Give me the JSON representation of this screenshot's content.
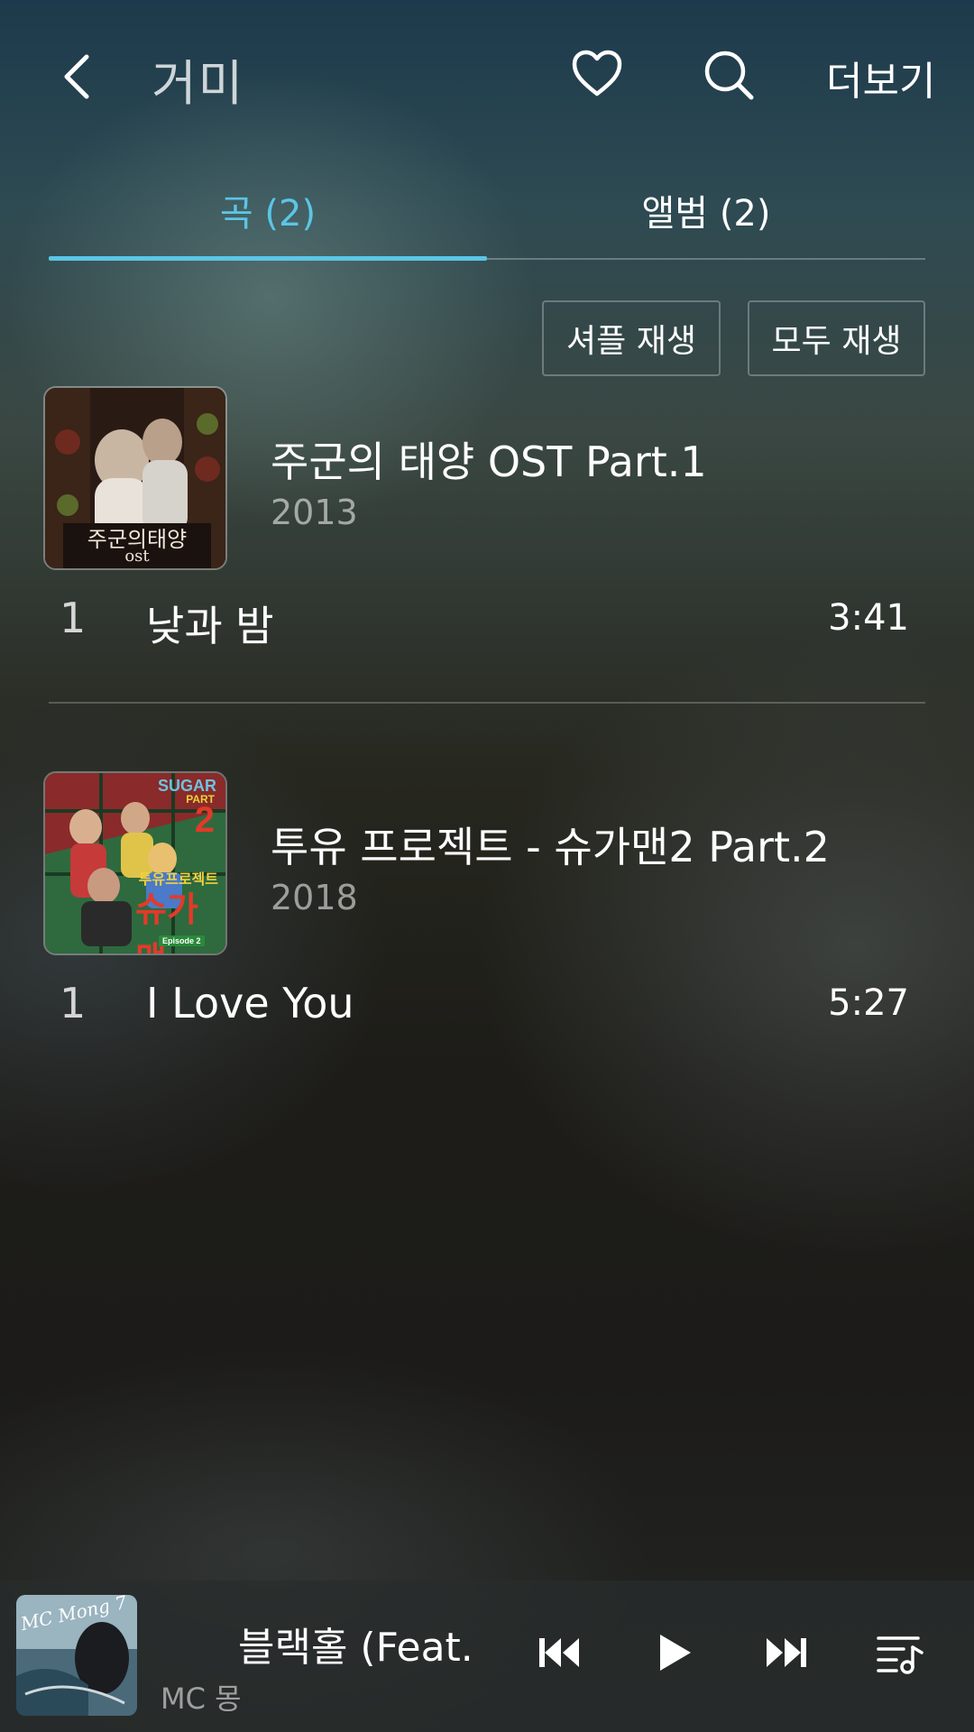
{
  "header": {
    "title": "거미",
    "more_label": "더보기"
  },
  "tabs": [
    {
      "label": "곡 (2)",
      "active": true
    },
    {
      "label": "앨범 (2)",
      "active": false
    }
  ],
  "actions": {
    "shuffle_label": "셔플 재생",
    "play_all_label": "모두 재생"
  },
  "albums": [
    {
      "title": "주군의 태양 OST Part.1",
      "year": "2013",
      "cover_text": "주군의태양",
      "cover_sub": "ost",
      "tracks": [
        {
          "number": "1",
          "title": "낮과 밤",
          "duration": "3:41"
        }
      ]
    },
    {
      "title": "투유 프로젝트 - 슈가맨2 Part.2",
      "year": "2018",
      "cover_text": "슈가맨",
      "cover_badge": "SUGAR",
      "cover_part": "PART",
      "cover_num": "2",
      "cover_project": "투유프로젝트",
      "cover_episode": "Episode 2",
      "tracks": [
        {
          "number": "1",
          "title": "I Love You",
          "duration": "5:27"
        }
      ]
    }
  ],
  "player": {
    "title": "블랙홀 (Feat. (",
    "artist": "MC 몽",
    "cover_text": "MC Mong 7"
  },
  "colors": {
    "accent": "#5bc6e6"
  },
  "icons": {
    "back": "chevron-left-icon",
    "favorite": "heart-icon",
    "search": "search-icon",
    "prev": "skip-previous-icon",
    "play": "play-icon",
    "next": "skip-next-icon",
    "queue": "playlist-icon"
  }
}
